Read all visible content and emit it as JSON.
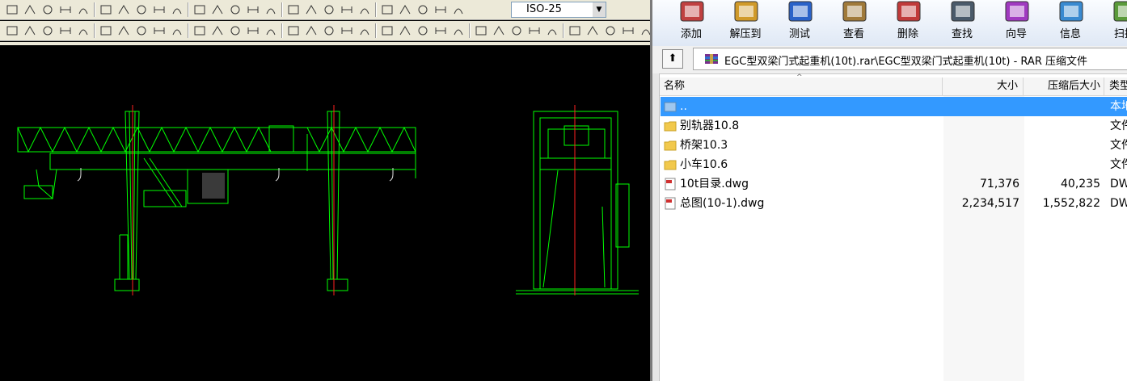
{
  "cad": {
    "dimstyle_value": "ISO-25",
    "toolbar_row1_icons": [
      "new-icon",
      "open-icon",
      "save-icon",
      "print-icon",
      "plot-preview-icon",
      "linear-dim-icon",
      "aligned-dim-icon",
      "arc-length-dim-icon",
      "ordinate-dim-icon",
      "radius-dim-icon",
      "jogged-dim-icon",
      "diameter-dim-icon",
      "angular-dim-icon",
      "quick-dim-icon",
      "baseline-dim-icon",
      "continue-dim-icon",
      "dim-space-icon",
      "dim-break-icon",
      "tolerance-icon",
      "center-mark-icon",
      "inspect-icon",
      "jogged-linear-icon",
      "dim-edit-icon",
      "dim-text-edit-icon",
      "dim-update-icon"
    ],
    "toolbar_row2_icons": [
      "rectangle-icon",
      "area-icon",
      "text-icon",
      "layer-icon",
      "match-icon",
      "color-icon",
      "linetype-icon",
      "snap-icon",
      "ortho-icon",
      "grid-icon",
      "lineweight-icon",
      "hatch-icon",
      "check-icon",
      "block-icon",
      "pie-icon",
      "arc-icon",
      "angle-icon",
      "symbol-icon"
    ]
  },
  "rar": {
    "toolbar": [
      {
        "label": "添加",
        "icon": "add-archive-icon"
      },
      {
        "label": "解压到",
        "icon": "extract-to-icon"
      },
      {
        "label": "测试",
        "icon": "test-icon"
      },
      {
        "label": "查看",
        "icon": "view-icon"
      },
      {
        "label": "删除",
        "icon": "delete-icon"
      },
      {
        "label": "查找",
        "icon": "find-icon"
      },
      {
        "label": "向导",
        "icon": "wizard-icon"
      },
      {
        "label": "信息",
        "icon": "info-icon"
      },
      {
        "label": "扫描",
        "icon": "scan-icon"
      }
    ],
    "address": "EGC型双梁门式起重机(10t).rar\\EGC型双梁门式起重机(10t) - RAR 压缩文件",
    "columns": {
      "name": "名称",
      "size": "大小",
      "packed": "压缩后大小",
      "type": "类型"
    },
    "rows": [
      {
        "name": "..",
        "size": "",
        "packed": "",
        "type": "本地",
        "kind": "parent"
      },
      {
        "name": "别轨器10.8",
        "size": "",
        "packed": "",
        "type": "文件",
        "kind": "folder"
      },
      {
        "name": "桥架10.3",
        "size": "",
        "packed": "",
        "type": "文件",
        "kind": "folder"
      },
      {
        "name": "小车10.6",
        "size": "",
        "packed": "",
        "type": "文件",
        "kind": "folder"
      },
      {
        "name": "10t目录.dwg",
        "size": "71,376",
        "packed": "40,235",
        "type": "DW",
        "kind": "dwg"
      },
      {
        "name": "总图(10-1).dwg",
        "size": "2,234,517",
        "packed": "1,552,822",
        "type": "DW",
        "kind": "dwg"
      }
    ]
  }
}
